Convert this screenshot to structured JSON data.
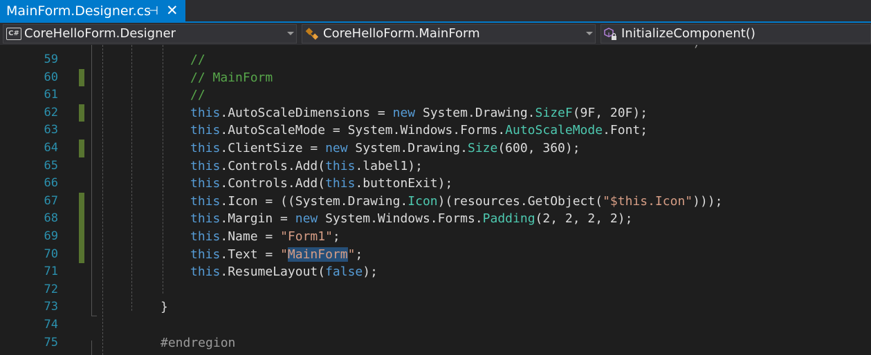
{
  "tab": {
    "title": "MainForm.Designer.cs",
    "pin_icon": "pin-icon",
    "close_icon": "close-icon"
  },
  "nav": {
    "project": "CoreHelloForm.Designer",
    "class": "CoreHelloForm.MainForm",
    "member": "InitializeComponent()"
  },
  "colors": {
    "accent": "#007acc",
    "line_number": "#2b91af",
    "change_marker": "#577430",
    "keyword": "#569cd6",
    "type": "#4ec9b0",
    "string": "#d69d85",
    "comment": "#57a64a"
  },
  "lines": {
    "l59": {
      "num": "59",
      "c1": "//"
    },
    "l60": {
      "num": "60",
      "c1": "// MainForm"
    },
    "l61": {
      "num": "61",
      "c1": "//"
    },
    "l62": {
      "num": "62",
      "k1": "this",
      "p1": ".AutoScaleDimensions = ",
      "k2": "new",
      "p2": " System.Drawing.",
      "t1": "SizeF",
      "p3": "(9F, 20F);"
    },
    "l63": {
      "num": "63",
      "k1": "this",
      "p1": ".AutoScaleMode = System.Windows.Forms.",
      "t1": "AutoScaleMode",
      "p2": ".Font;"
    },
    "l64": {
      "num": "64",
      "k1": "this",
      "p1": ".ClientSize = ",
      "k2": "new",
      "p2": " System.Drawing.",
      "t1": "Size",
      "p3": "(600, 360);"
    },
    "l65": {
      "num": "65",
      "k1": "this",
      "p1": ".Controls.Add(",
      "k2": "this",
      "p2": ".label1);"
    },
    "l66": {
      "num": "66",
      "k1": "this",
      "p1": ".Controls.Add(",
      "k2": "this",
      "p2": ".buttonExit);"
    },
    "l67": {
      "num": "67",
      "k1": "this",
      "p1": ".Icon = ((System.Drawing.",
      "t1": "Icon",
      "p2": ")(resources.GetObject(",
      "s1": "\"$this.Icon\"",
      "p3": ")));"
    },
    "l68": {
      "num": "68",
      "k1": "this",
      "p1": ".Margin = ",
      "k2": "new",
      "p2": " System.Windows.Forms.",
      "t1": "Padding",
      "p3": "(2, 2, 2, 2);"
    },
    "l69": {
      "num": "69",
      "k1": "this",
      "p1": ".Name = ",
      "s1": "\"Form1\"",
      "p2": ";"
    },
    "l70": {
      "num": "70",
      "k1": "this",
      "p1": ".Text = ",
      "s1": "\"",
      "sel": "MainForm",
      "s2": "\"",
      "p2": ";"
    },
    "l71": {
      "num": "71",
      "k1": "this",
      "p1": ".ResumeLayout(",
      "k2": "false",
      "p2": ");"
    },
    "l72": {
      "num": "72"
    },
    "l73": {
      "num": "73",
      "p1": "}"
    },
    "l74": {
      "num": "74"
    },
    "l75": {
      "num": "75",
      "p1": "#endregion"
    }
  }
}
